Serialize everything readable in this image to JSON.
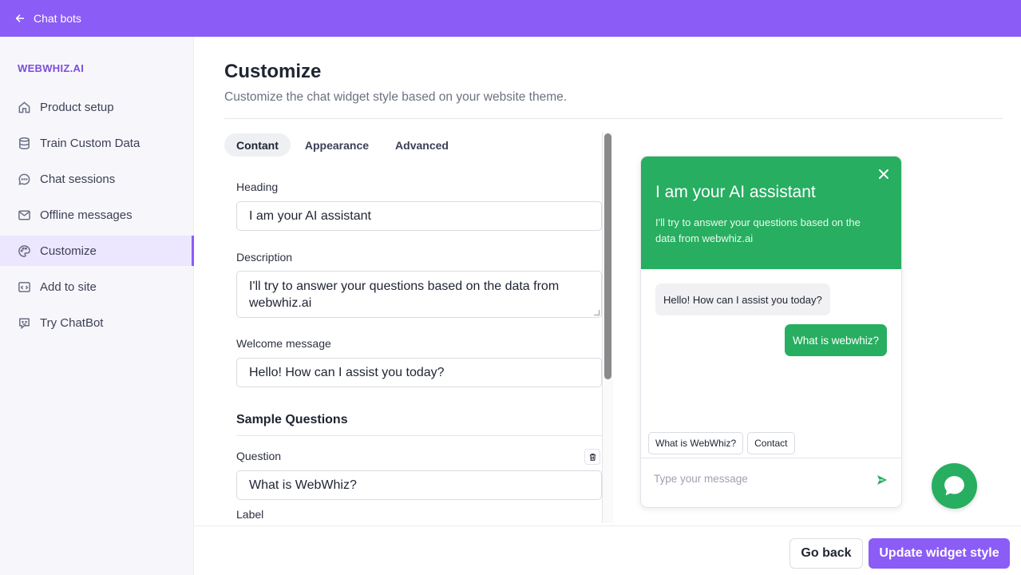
{
  "topbar": {
    "back_label": "Chat bots"
  },
  "sidebar": {
    "brand": "WEBWHIZ.AI",
    "items": [
      {
        "label": "Product setup",
        "icon": "home-icon",
        "active": false
      },
      {
        "label": "Train Custom Data",
        "icon": "database-icon",
        "active": false
      },
      {
        "label": "Chat sessions",
        "icon": "chat-bubble-icon",
        "active": false
      },
      {
        "label": "Offline messages",
        "icon": "mail-icon",
        "active": false
      },
      {
        "label": "Customize",
        "icon": "palette-icon",
        "active": true
      },
      {
        "label": "Add to site",
        "icon": "code-icon",
        "active": false
      },
      {
        "label": "Try ChatBot",
        "icon": "bot-icon",
        "active": false
      }
    ]
  },
  "page": {
    "title": "Customize",
    "subtitle": "Customize the chat widget style based on your website theme."
  },
  "tabs": [
    {
      "label": "Contant",
      "active": true
    },
    {
      "label": "Appearance",
      "active": false
    },
    {
      "label": "Advanced",
      "active": false
    }
  ],
  "form": {
    "heading_label": "Heading",
    "heading_value": "I am your AI assistant",
    "description_label": "Description",
    "description_value": "I'll try to answer your questions based on the data from webwhiz.ai",
    "welcome_label": "Welcome message",
    "welcome_value": "Hello! How can I assist you today?",
    "sample_questions_title": "Sample Questions",
    "question_label": "Question",
    "question_value": "What is WebWhiz?",
    "label_label": "Label"
  },
  "widget": {
    "title": "I am your AI assistant",
    "description": "I'll try to answer your questions based on the data from webwhiz.ai",
    "bot_message": "Hello! How can I assist you today?",
    "user_message": "What is webwhiz?",
    "chips": [
      "What is WebWhiz?",
      "Contact"
    ],
    "input_placeholder": "Type your message",
    "accent_color": "#27ae60"
  },
  "footer": {
    "back_label": "Go back",
    "update_label": "Update widget style"
  },
  "colors": {
    "brand": "#8b5cf6",
    "active_nav_bg": "#ede6ff"
  }
}
